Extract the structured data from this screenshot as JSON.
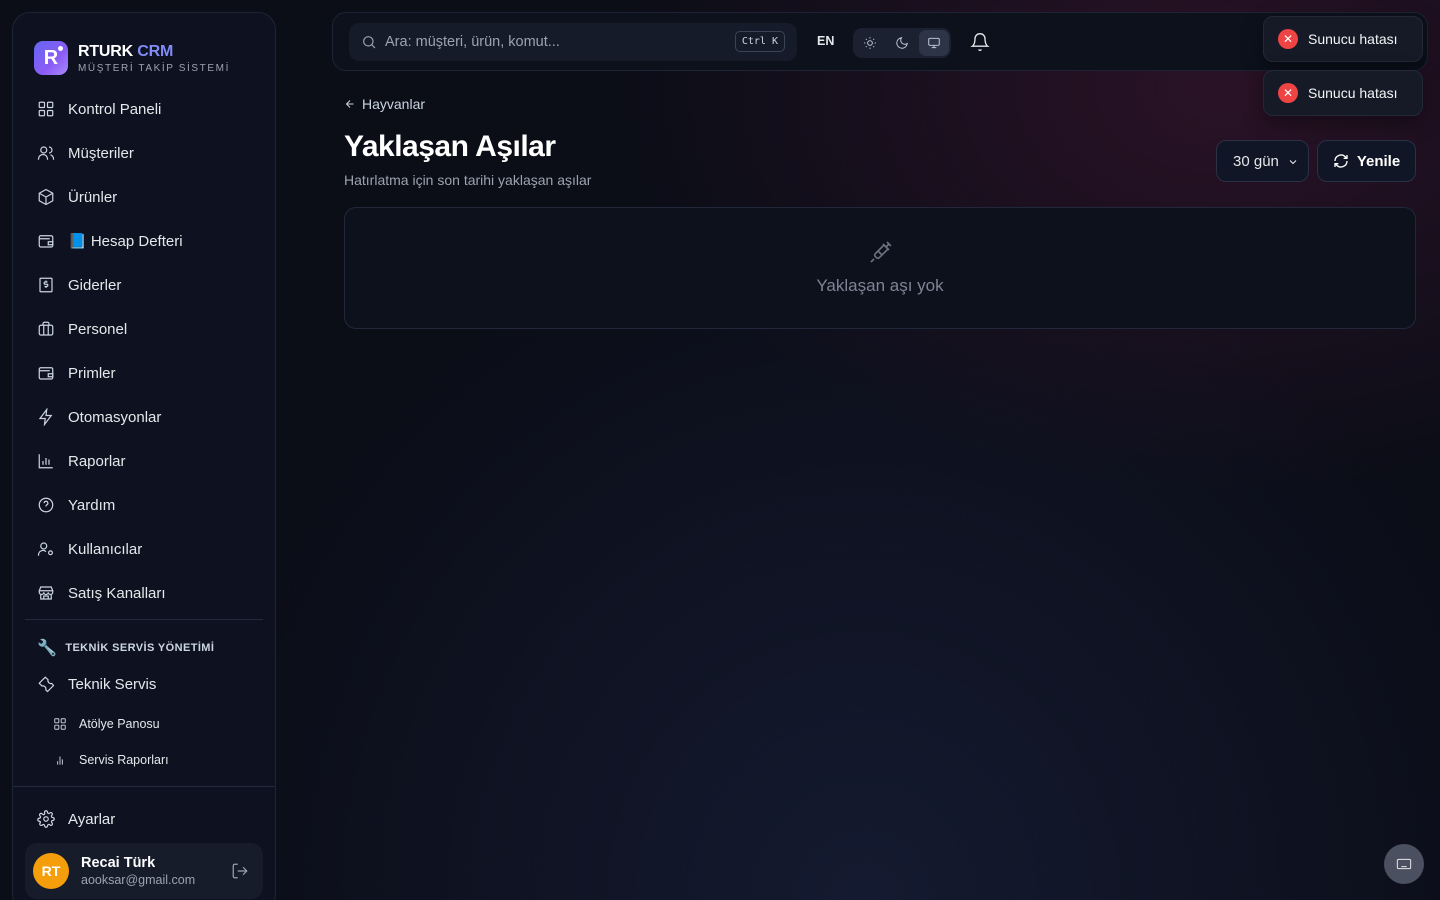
{
  "brand": {
    "name": "RTURK",
    "name_accent": "CRM",
    "subtitle": "MÜŞTERİ TAKİP SİSTEMİ",
    "logo_letter": "R"
  },
  "sidebar": {
    "items": [
      {
        "label": "Kontrol Paneli",
        "icon": "dashboard-icon"
      },
      {
        "label": "Müşteriler",
        "icon": "users-icon"
      },
      {
        "label": "Ürünler",
        "icon": "box-icon"
      },
      {
        "label": "📘 Hesap Defteri",
        "icon": "wallet-icon"
      },
      {
        "label": "Giderler",
        "icon": "receipt-icon"
      },
      {
        "label": "Personel",
        "icon": "briefcase-icon"
      },
      {
        "label": "Primler",
        "icon": "wallet-icon"
      },
      {
        "label": "Otomasyonlar",
        "icon": "zap-icon"
      },
      {
        "label": "Raporlar",
        "icon": "bar-chart-icon"
      },
      {
        "label": "Yardım",
        "icon": "help-icon"
      },
      {
        "label": "Kullanıcılar",
        "icon": "user-cog-icon"
      },
      {
        "label": "Satış Kanalları",
        "icon": "store-icon"
      }
    ],
    "section_title": "TEKNİK SERVİS YÖNETİMİ",
    "service": {
      "label": "Teknik Servis"
    },
    "sub_items": [
      {
        "label": "Atölye Panosu"
      },
      {
        "label": "Servis Raporları"
      }
    ],
    "settings_label": "Ayarlar",
    "user": {
      "initials": "RT",
      "name": "Recai Türk",
      "email": "aooksar@gmail.com"
    }
  },
  "topbar": {
    "search_placeholder": "Ara: müşteri, ürün, komut...",
    "shortcut": "Ctrl K",
    "lang": "EN",
    "theme_active": "system"
  },
  "toasts": [
    {
      "message": "Sunucu hatası"
    },
    {
      "message": "Sunucu hatası"
    }
  ],
  "main": {
    "back_label": "Hayvanlar",
    "title": "Yaklaşan Aşılar",
    "subtitle": "Hatırlatma için son tarihi yaklaşan aşılar",
    "period_value": "30 gün",
    "refresh_label": "Yenile",
    "empty_text": "Yaklaşan aşı yok"
  },
  "colors": {
    "accent": "#818cf8",
    "error": "#ef4444",
    "avatar": "#f59e0b",
    "background": "#0b0d17"
  }
}
